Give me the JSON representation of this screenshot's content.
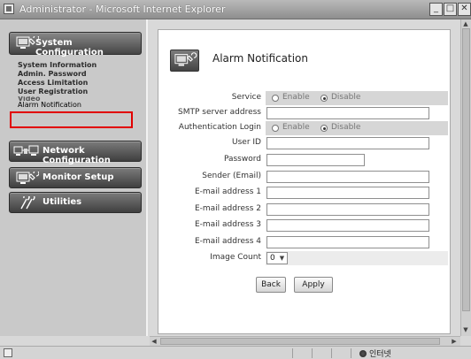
{
  "window": {
    "title": "Administrator - Microsoft Internet Explorer",
    "controls": [
      "minimize",
      "maximize",
      "close"
    ]
  },
  "sidebar": {
    "system_configuration": {
      "label": "System Configuration",
      "items": [
        {
          "label": "System Information"
        },
        {
          "label": "Admin. Password"
        },
        {
          "label": "Access Limitation"
        },
        {
          "label": "User Registration"
        },
        {
          "label": "Video"
        },
        {
          "label": "Alarm Notification",
          "selected": true
        }
      ]
    },
    "network_configuration": {
      "label": "Network Configuration"
    },
    "monitor_setup": {
      "label": "Monitor Setup"
    },
    "utilities": {
      "label": "Utilities"
    }
  },
  "page": {
    "title": "Alarm Notification",
    "icon": "alarm-device-icon"
  },
  "form": {
    "service": {
      "label": "Service",
      "options": [
        "Enable",
        "Disable"
      ],
      "selected": "Disable"
    },
    "smtp_server": {
      "label": "SMTP server address",
      "value": ""
    },
    "auth_login": {
      "label": "Authentication Login",
      "options": [
        "Enable",
        "Disable"
      ],
      "selected": "Disable"
    },
    "user_id": {
      "label": "User ID",
      "value": ""
    },
    "password": {
      "label": "Password",
      "value": ""
    },
    "sender": {
      "label": "Sender (Email)",
      "value": ""
    },
    "email1": {
      "label": "E-mail address 1",
      "value": ""
    },
    "email2": {
      "label": "E-mail address 2",
      "value": ""
    },
    "email3": {
      "label": "E-mail address 3",
      "value": ""
    },
    "email4": {
      "label": "E-mail address 4",
      "value": ""
    },
    "image_count": {
      "label": "Image Count",
      "value": "0"
    }
  },
  "buttons": {
    "back": "Back",
    "apply": "Apply"
  },
  "statusbar": {
    "zone": "인터넷"
  },
  "colors": {
    "highlight": "#e10000",
    "nav_button": "#4a4a4a"
  }
}
